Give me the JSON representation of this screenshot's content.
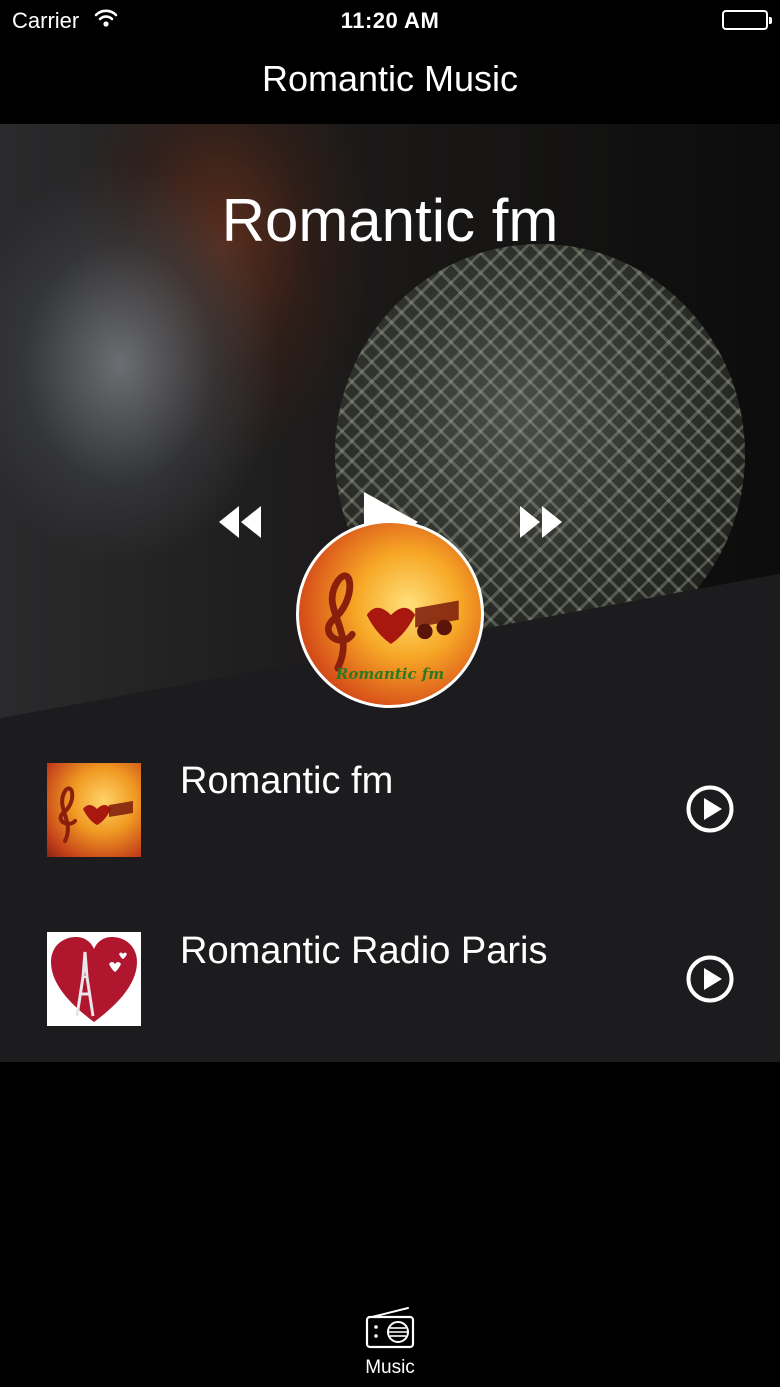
{
  "status_bar": {
    "carrier": "Carrier",
    "time": "11:20 AM"
  },
  "nav": {
    "title": "Romantic Music"
  },
  "player": {
    "station_title": "Romantic fm",
    "controls": [
      "rewind-icon",
      "play-icon",
      "fast-forward-icon"
    ],
    "artwork_caption": "Romantic fm"
  },
  "stations": [
    {
      "name": "Romantic fm",
      "icon": "play-circle-icon"
    },
    {
      "name": "Romantic Radio Paris",
      "icon": "play-circle-icon"
    }
  ],
  "tabs": [
    {
      "label": "Music",
      "icon": "radio-icon"
    }
  ],
  "colors": {
    "background": "#000000",
    "list_background": "#1c1c1e",
    "text": "#ffffff"
  }
}
